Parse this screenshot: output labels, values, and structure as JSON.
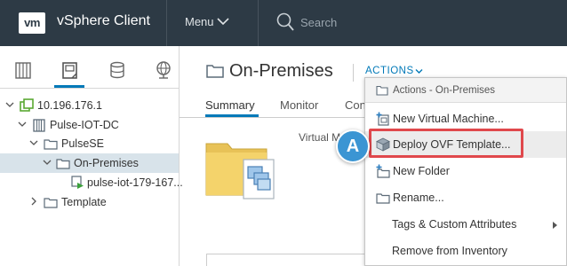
{
  "header": {
    "logo_text": "vm",
    "app_title": "vSphere Client",
    "menu_label": "Menu",
    "search_placeholder": "Search"
  },
  "nav_icons": [
    "hosts-clusters-icon",
    "vms-templates-icon",
    "storage-icon",
    "networking-icon"
  ],
  "tree": [
    {
      "label": "10.196.176.1",
      "icon": "vcenter-icon",
      "expanded": true
    },
    {
      "label": "Pulse-IOT-DC",
      "icon": "datacenter-icon",
      "expanded": true
    },
    {
      "label": "PulseSE",
      "icon": "folder-icon",
      "expanded": true
    },
    {
      "label": "On-Premises",
      "icon": "folder-icon",
      "expanded": true,
      "selected": true
    },
    {
      "label": "pulse-iot-179-167...",
      "icon": "vm-icon"
    },
    {
      "label": "Template",
      "icon": "folder-icon",
      "expanded": false
    }
  ],
  "main": {
    "title": "On-Premises",
    "actions_label": "ACTIONS",
    "tabs": [
      "Summary",
      "Monitor",
      "Con"
    ],
    "summary_label": "Virtual M"
  },
  "dropdown": {
    "header": "Actions - On-Premises",
    "items": [
      {
        "label": "New Virtual Machine...",
        "icon": "new-vm-icon"
      },
      {
        "label": "Deploy OVF Template...",
        "icon": "deploy-ovf-icon",
        "highlighted": true
      },
      {
        "label": "New Folder",
        "icon": "new-folder-icon"
      },
      {
        "label": "Rename...",
        "icon": "rename-icon"
      },
      {
        "label": "Tags & Custom Attributes",
        "submenu": true
      },
      {
        "label": "Remove from Inventory"
      }
    ]
  },
  "callout": {
    "label": "A"
  },
  "colors": {
    "header_bg": "#2d3a45",
    "accent": "#0079b8",
    "highlight_border": "#e0484c",
    "callout_bg": "#3b95d3",
    "selected_row": "#d8e3ea",
    "folder_yellow": "#f4d36b"
  }
}
